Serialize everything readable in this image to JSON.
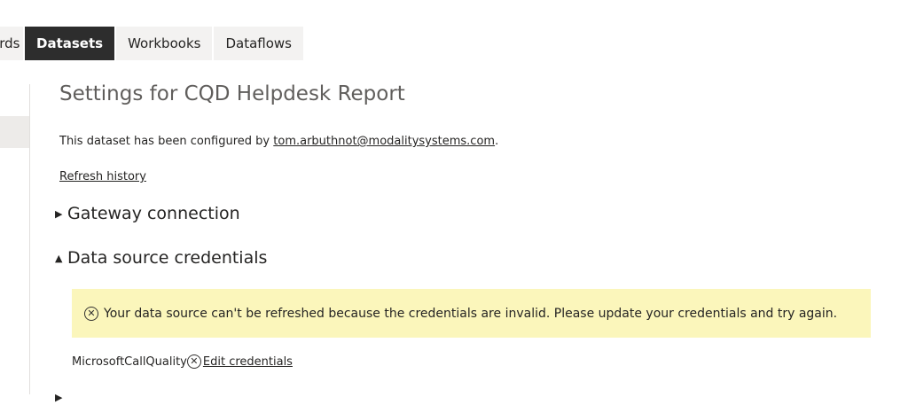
{
  "tabs": [
    {
      "label": "ards",
      "active": false
    },
    {
      "label": "Datasets",
      "active": true
    },
    {
      "label": "Workbooks",
      "active": false
    },
    {
      "label": "Dataflows",
      "active": false
    }
  ],
  "settings": {
    "title": "Settings for CQD Helpdesk Report",
    "configured_prefix": "This dataset has been configured by",
    "configured_email": "tom.arbuthnot@modalitysystems.com",
    "configured_suffix": ".",
    "refresh_history": "Refresh history"
  },
  "sections": {
    "gateway": {
      "label": "Gateway connection",
      "expanded": false
    },
    "credentials": {
      "label": "Data source credentials",
      "expanded": true
    }
  },
  "alert": {
    "message": "Your data source can't be refreshed because the credentials are invalid. Please update your credentials and try again.",
    "color": "#fbf6bb"
  },
  "credential_row": {
    "source_name": "MicrosoftCallQuality",
    "edit_link": "Edit credentials"
  },
  "colors": {
    "active_tab_bg": "#2d2d2d",
    "tab_bg": "#f3f2f1"
  }
}
